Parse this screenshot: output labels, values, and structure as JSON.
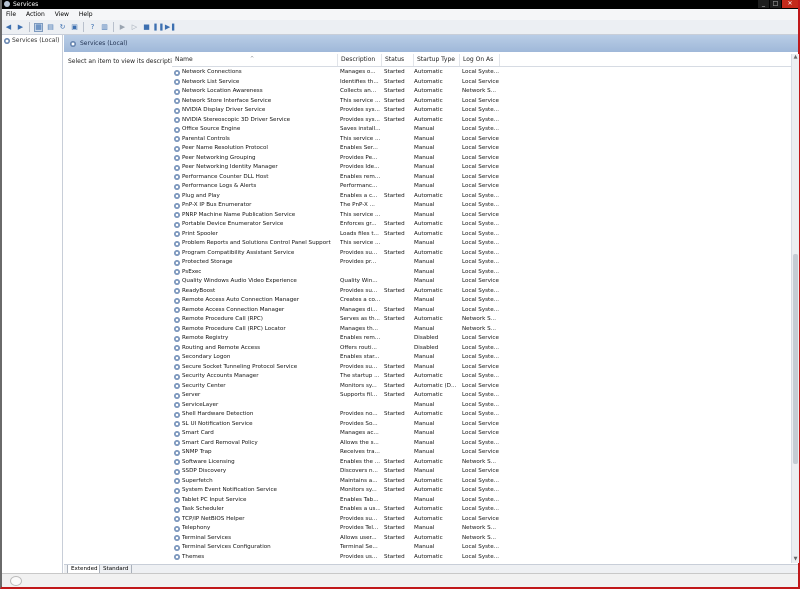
{
  "window": {
    "title": "Services",
    "min": "_",
    "max": "□",
    "close": "✕"
  },
  "menu": [
    "File",
    "Action",
    "View",
    "Help"
  ],
  "tree": {
    "item": "Services (Local)"
  },
  "panel": {
    "header": "Services (Local)",
    "hint": "Select an item to view its description."
  },
  "columns": {
    "name": "Name",
    "description": "Description",
    "status": "Status",
    "startup": "Startup Type",
    "logon": "Log On As"
  },
  "rows": [
    {
      "name": "Network Connections",
      "desc": "Manages o...",
      "status": "Started",
      "startup": "Automatic",
      "logon": "Local Syste..."
    },
    {
      "name": "Network List Service",
      "desc": "Identifies th...",
      "status": "Started",
      "startup": "Automatic",
      "logon": "Local Service"
    },
    {
      "name": "Network Location Awareness",
      "desc": "Collects an...",
      "status": "Started",
      "startup": "Automatic",
      "logon": "Network S..."
    },
    {
      "name": "Network Store Interface Service",
      "desc": "This service ...",
      "status": "Started",
      "startup": "Automatic",
      "logon": "Local Service"
    },
    {
      "name": "NVIDIA Display Driver Service",
      "desc": "Provides sys...",
      "status": "Started",
      "startup": "Automatic",
      "logon": "Local Syste..."
    },
    {
      "name": "NVIDIA Stereoscopic 3D Driver Service",
      "desc": "Provides sys...",
      "status": "Started",
      "startup": "Automatic",
      "logon": "Local Syste..."
    },
    {
      "name": "Office Source Engine",
      "desc": "Saves install...",
      "status": "",
      "startup": "Manual",
      "logon": "Local Syste..."
    },
    {
      "name": "Parental Controls",
      "desc": "This service ...",
      "status": "",
      "startup": "Manual",
      "logon": "Local Service"
    },
    {
      "name": "Peer Name Resolution Protocol",
      "desc": "Enables Ser...",
      "status": "",
      "startup": "Manual",
      "logon": "Local Service"
    },
    {
      "name": "Peer Networking Grouping",
      "desc": "Provides Pe...",
      "status": "",
      "startup": "Manual",
      "logon": "Local Service"
    },
    {
      "name": "Peer Networking Identity Manager",
      "desc": "Provides Ide...",
      "status": "",
      "startup": "Manual",
      "logon": "Local Service"
    },
    {
      "name": "Performance Counter DLL Host",
      "desc": "Enables rem...",
      "status": "",
      "startup": "Manual",
      "logon": "Local Service"
    },
    {
      "name": "Performance Logs & Alerts",
      "desc": "Performanc...",
      "status": "",
      "startup": "Manual",
      "logon": "Local Service"
    },
    {
      "name": "Plug and Play",
      "desc": "Enables a c...",
      "status": "Started",
      "startup": "Automatic",
      "logon": "Local Syste..."
    },
    {
      "name": "PnP-X IP Bus Enumerator",
      "desc": "The PnP-X ...",
      "status": "",
      "startup": "Manual",
      "logon": "Local Syste..."
    },
    {
      "name": "PNRP Machine Name Publication Service",
      "desc": "This service ...",
      "status": "",
      "startup": "Manual",
      "logon": "Local Service"
    },
    {
      "name": "Portable Device Enumerator Service",
      "desc": "Enforces gr...",
      "status": "Started",
      "startup": "Automatic",
      "logon": "Local Syste..."
    },
    {
      "name": "Print Spooler",
      "desc": "Loads files t...",
      "status": "Started",
      "startup": "Automatic",
      "logon": "Local Syste..."
    },
    {
      "name": "Problem Reports and Solutions Control Panel Support",
      "desc": "This service ...",
      "status": "",
      "startup": "Manual",
      "logon": "Local Syste..."
    },
    {
      "name": "Program Compatibility Assistant Service",
      "desc": "Provides su...",
      "status": "Started",
      "startup": "Automatic",
      "logon": "Local Syste..."
    },
    {
      "name": "Protected Storage",
      "desc": "Provides pr...",
      "status": "",
      "startup": "Manual",
      "logon": "Local Syste..."
    },
    {
      "name": "PsExec",
      "desc": "",
      "status": "",
      "startup": "Manual",
      "logon": "Local Syste..."
    },
    {
      "name": "Quality Windows Audio Video Experience",
      "desc": "Quality Win...",
      "status": "",
      "startup": "Manual",
      "logon": "Local Service"
    },
    {
      "name": "ReadyBoost",
      "desc": "Provides su...",
      "status": "Started",
      "startup": "Automatic",
      "logon": "Local Syste..."
    },
    {
      "name": "Remote Access Auto Connection Manager",
      "desc": "Creates a co...",
      "status": "",
      "startup": "Manual",
      "logon": "Local Syste..."
    },
    {
      "name": "Remote Access Connection Manager",
      "desc": "Manages di...",
      "status": "Started",
      "startup": "Manual",
      "logon": "Local Syste..."
    },
    {
      "name": "Remote Procedure Call (RPC)",
      "desc": "Serves as th...",
      "status": "Started",
      "startup": "Automatic",
      "logon": "Network S..."
    },
    {
      "name": "Remote Procedure Call (RPC) Locator",
      "desc": "Manages th...",
      "status": "",
      "startup": "Manual",
      "logon": "Network S..."
    },
    {
      "name": "Remote Registry",
      "desc": "Enables rem...",
      "status": "",
      "startup": "Disabled",
      "logon": "Local Service"
    },
    {
      "name": "Routing and Remote Access",
      "desc": "Offers routi...",
      "status": "",
      "startup": "Disabled",
      "logon": "Local Syste..."
    },
    {
      "name": "Secondary Logon",
      "desc": "Enables star...",
      "status": "",
      "startup": "Manual",
      "logon": "Local Syste..."
    },
    {
      "name": "Secure Socket Tunneling Protocol Service",
      "desc": "Provides su...",
      "status": "Started",
      "startup": "Manual",
      "logon": "Local Service"
    },
    {
      "name": "Security Accounts Manager",
      "desc": "The startup ...",
      "status": "Started",
      "startup": "Automatic",
      "logon": "Local Syste..."
    },
    {
      "name": "Security Center",
      "desc": "Monitors sy...",
      "status": "Started",
      "startup": "Automatic (D...",
      "logon": "Local Service"
    },
    {
      "name": "Server",
      "desc": "Supports fil...",
      "status": "Started",
      "startup": "Automatic",
      "logon": "Local Syste..."
    },
    {
      "name": "ServiceLayer",
      "desc": "",
      "status": "",
      "startup": "Manual",
      "logon": "Local Syste..."
    },
    {
      "name": "Shell Hardware Detection",
      "desc": "Provides no...",
      "status": "Started",
      "startup": "Automatic",
      "logon": "Local Syste..."
    },
    {
      "name": "SL UI Notification Service",
      "desc": "Provides So...",
      "status": "",
      "startup": "Manual",
      "logon": "Local Service"
    },
    {
      "name": "Smart Card",
      "desc": "Manages ac...",
      "status": "",
      "startup": "Manual",
      "logon": "Local Service"
    },
    {
      "name": "Smart Card Removal Policy",
      "desc": "Allows the s...",
      "status": "",
      "startup": "Manual",
      "logon": "Local Syste..."
    },
    {
      "name": "SNMP Trap",
      "desc": "Receives tra...",
      "status": "",
      "startup": "Manual",
      "logon": "Local Service"
    },
    {
      "name": "Software Licensing",
      "desc": "Enables the ...",
      "status": "Started",
      "startup": "Automatic",
      "logon": "Network S..."
    },
    {
      "name": "SSDP Discovery",
      "desc": "Discovers n...",
      "status": "Started",
      "startup": "Manual",
      "logon": "Local Service"
    },
    {
      "name": "Superfetch",
      "desc": "Maintains a...",
      "status": "Started",
      "startup": "Automatic",
      "logon": "Local Syste..."
    },
    {
      "name": "System Event Notification Service",
      "desc": "Monitors sy...",
      "status": "Started",
      "startup": "Automatic",
      "logon": "Local Syste..."
    },
    {
      "name": "Tablet PC Input Service",
      "desc": "Enables Tab...",
      "status": "",
      "startup": "Manual",
      "logon": "Local Syste..."
    },
    {
      "name": "Task Scheduler",
      "desc": "Enables a us...",
      "status": "Started",
      "startup": "Automatic",
      "logon": "Local Syste..."
    },
    {
      "name": "TCP/IP NetBIOS Helper",
      "desc": "Provides su...",
      "status": "Started",
      "startup": "Automatic",
      "logon": "Local Service"
    },
    {
      "name": "Telephony",
      "desc": "Provides Tel...",
      "status": "Started",
      "startup": "Manual",
      "logon": "Network S..."
    },
    {
      "name": "Terminal Services",
      "desc": "Allows user...",
      "status": "Started",
      "startup": "Automatic",
      "logon": "Network S..."
    },
    {
      "name": "Terminal Services Configuration",
      "desc": "Terminal Se...",
      "status": "",
      "startup": "Manual",
      "logon": "Local Syste..."
    },
    {
      "name": "Themes",
      "desc": "Provides us...",
      "status": "Started",
      "startup": "Automatic",
      "logon": "Local Syste..."
    }
  ],
  "tabs": {
    "extended": "Extended",
    "standard": "Standard"
  },
  "colors": {
    "accent": "#9fb8d9",
    "window_border": "#c0181a",
    "titlebar": "#000000"
  }
}
